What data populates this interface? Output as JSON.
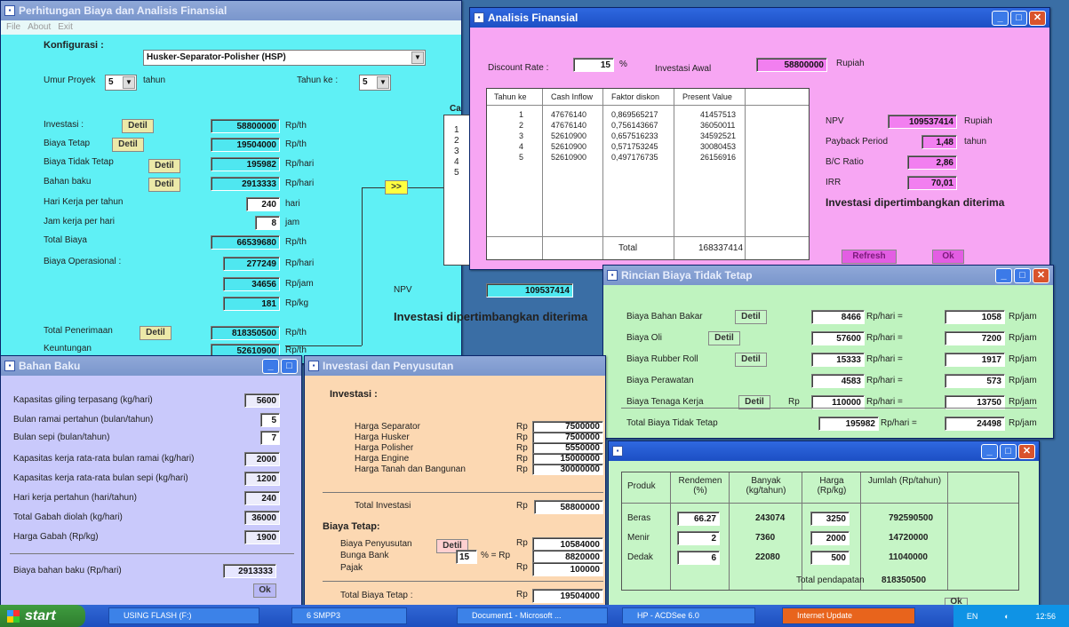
{
  "main": {
    "title": "Perhitungan Biaya dan Analisis Finansial",
    "menu": [
      "File",
      "About",
      "Exit"
    ],
    "konfig_label": "Konfigurasi :",
    "konfig_value": "Husker-Separator-Polisher (HSP)",
    "umur_label": "Umur Proyek",
    "umur_value": "5",
    "umur_unit": "tahun",
    "tahunke_label": "Tahun ke :",
    "tahunke_value": "5",
    "rows": [
      {
        "label": "Investasi :",
        "value": "58800000",
        "unit": "Rp/th",
        "btn": "Detil"
      },
      {
        "label": "Biaya Tetap",
        "value": "19504000",
        "unit": "Rp/th",
        "btn": "Detil"
      },
      {
        "label": "Biaya Tidak Tetap",
        "value": "195982",
        "unit": "Rp/hari",
        "btn": "Detil"
      },
      {
        "label": "Bahan baku",
        "value": "2913333",
        "unit": "Rp/hari",
        "btn": "Detil"
      },
      {
        "label": "Hari Kerja per tahun",
        "value": "240",
        "unit": "hari"
      },
      {
        "label": "Jam kerja per hari",
        "value": "8",
        "unit": "jam"
      },
      {
        "label": "Total Biaya",
        "value": "66539680",
        "unit": "Rp/th"
      },
      {
        "label": "Biaya Operasional :",
        "value": "277249",
        "unit": "Rp/hari"
      },
      {
        "label": "",
        "value": "34656",
        "unit": "Rp/jam"
      },
      {
        "label": "",
        "value": "181",
        "unit": "Rp/kg"
      },
      {
        "label": "Total Penerimaan",
        "value": "818350500",
        "unit": "Rp/th",
        "btn": "Detil"
      },
      {
        "label": "Keuntungan",
        "value": "52610900",
        "unit": "Rp/th"
      }
    ],
    "arrow_btn": ">>",
    "ca_label": "Ca",
    "ca_years": [
      "1",
      "2",
      "3",
      "4",
      "5"
    ],
    "npv_label": "NPV",
    "npv_value": "109537414",
    "note": "Investasi dipertimbangkan diterima"
  },
  "analisis": {
    "title": "Analisis Finansial",
    "discount_label": "Discount Rate :",
    "discount_value": "15",
    "discount_unit": "%",
    "inv_label": "Investasi Awal",
    "inv_value": "58800000",
    "inv_unit": "Rupiah",
    "headers": [
      "Tahun ke",
      "Cash Inflow",
      "Faktor diskon",
      "Present Value"
    ],
    "rows": [
      [
        "1",
        "47676140",
        "0,869565217",
        "41457513"
      ],
      [
        "2",
        "47676140",
        "0,756143667",
        "36050011"
      ],
      [
        "3",
        "52610900",
        "0,657516233",
        "34592521"
      ],
      [
        "4",
        "52610900",
        "0,571753245",
        "30080453"
      ],
      [
        "5",
        "52610900",
        "0,497176735",
        "26156916"
      ]
    ],
    "total_label": "Total",
    "total_value": "168337414",
    "npv_label": "NPV",
    "npv_value": "109537414",
    "npv_unit": "Rupiah",
    "payback_label": "Payback Period",
    "payback_value": "1,48",
    "payback_unit": "tahun",
    "bc_label": "B/C Ratio",
    "bc_value": "2,86",
    "irr_label": "IRR",
    "irr_value": "70,01",
    "note": "Investasi dipertimbangkan diterima",
    "refresh": "Refresh",
    "ok": "Ok"
  },
  "rincian": {
    "title": "Rincian Biaya Tidak Tetap",
    "rows": [
      {
        "label": "Biaya Bahan Bakar",
        "btn": "Detil",
        "v1": "8466",
        "u1": "Rp/hari =",
        "v2": "1058",
        "u2": "Rp/jam"
      },
      {
        "label": "Biaya Oli",
        "btn": "Detil",
        "v1": "57600",
        "u1": "Rp/hari =",
        "v2": "7200",
        "u2": "Rp/jam"
      },
      {
        "label": "Biaya Rubber Roll",
        "btn": "Detil",
        "v1": "15333",
        "u1": "Rp/hari =",
        "v2": "1917",
        "u2": "Rp/jam"
      },
      {
        "label": "Biaya Perawatan",
        "v1": "4583",
        "u1": "Rp/hari =",
        "v2": "573",
        "u2": "Rp/jam"
      },
      {
        "label": "Biaya Tenaga Kerja",
        "btn": "Detil",
        "pre": "Rp",
        "v1": "110000",
        "u1": "Rp/hari =",
        "v2": "13750",
        "u2": "Rp/jam"
      }
    ],
    "total_label": "Total Biaya Tidak Tetap",
    "total_v1": "195982",
    "total_u1": "Rp/hari =",
    "total_v2": "24498",
    "total_u2": "Rp/jam"
  },
  "bahan": {
    "title": "Bahan Baku",
    "rows": [
      {
        "label": "Kapasitas giling terpasang (kg/hari)",
        "value": "5600"
      },
      {
        "label": "Bulan ramai pertahun (bulan/tahun)",
        "value": "5"
      },
      {
        "label": "Bulan sepi (bulan/tahun)",
        "value": "7"
      },
      {
        "label": "Kapasitas kerja rata-rata bulan ramai (kg/hari)",
        "value": "2000"
      },
      {
        "label": "Kapasitas kerja rata-rata bulan sepi (kg/hari)",
        "value": "1200"
      },
      {
        "label": "Hari kerja pertahun (hari/tahun)",
        "value": "240"
      },
      {
        "label": "Total Gabah diolah (kg/hari)",
        "value": "36000"
      },
      {
        "label": "Harga Gabah (Rp/kg)",
        "value": "1900"
      }
    ],
    "biaya_label": "Biaya bahan baku (Rp/hari)",
    "biaya_value": "2913333",
    "ok": "Ok"
  },
  "investasi": {
    "title": "Investasi dan Penyusutan",
    "inv_heading": "Investasi :",
    "items": [
      {
        "label": "Harga Separator",
        "cur": "Rp",
        "value": "7500000"
      },
      {
        "label": "Harga Husker",
        "cur": "Rp",
        "value": "7500000"
      },
      {
        "label": "Harga Polisher",
        "cur": "Rp",
        "value": "5550000"
      },
      {
        "label": "Harga Engine",
        "cur": "Rp",
        "value": "15000000"
      },
      {
        "label": "Harga Tanah dan Bangunan",
        "cur": "Rp",
        "value": "30000000"
      }
    ],
    "total_label": "Total Investasi",
    "total_cur": "Rp",
    "total_value": "58800000",
    "tetap_heading": "Biaya Tetap:",
    "peny_label": "Biaya Penyusutan",
    "peny_btn": "Detil",
    "peny_cur": "Rp",
    "peny_value": "10584000",
    "bunga_label": "Bunga Bank",
    "bunga_rate": "15",
    "bunga_unit": "% = Rp",
    "bunga_value": "8820000",
    "pajak_label": "Pajak",
    "pajak_cur": "Rp",
    "pajak_value": "100000",
    "tt_label": "Total Biaya Tetap :",
    "tt_cur": "Rp",
    "tt_value": "19504000"
  },
  "produk": {
    "headers": [
      "Produk",
      "Rendemen (%)",
      "Banyak (kg/tahun)",
      "Harga (Rp/kg)",
      "Jumlah (Rp/tahun)"
    ],
    "rows": [
      [
        "Beras",
        "66.27",
        "243074",
        "3250",
        "792590500"
      ],
      [
        "Menir",
        "2",
        "7360",
        "2000",
        "14720000"
      ],
      [
        "Dedak",
        "6",
        "22080",
        "500",
        "11040000"
      ]
    ],
    "total_label": "Total pendapatan",
    "total_value": "818350500",
    "ok": "Ok"
  },
  "taskbar": {
    "start": "start",
    "items": [
      "USING FLASH (F:)",
      "6 SMPP3",
      "Document1 - Microsoft ...",
      "HP - ACDSee 6.0",
      "Internet Update"
    ],
    "lang": "EN",
    "clock": "12:56"
  }
}
